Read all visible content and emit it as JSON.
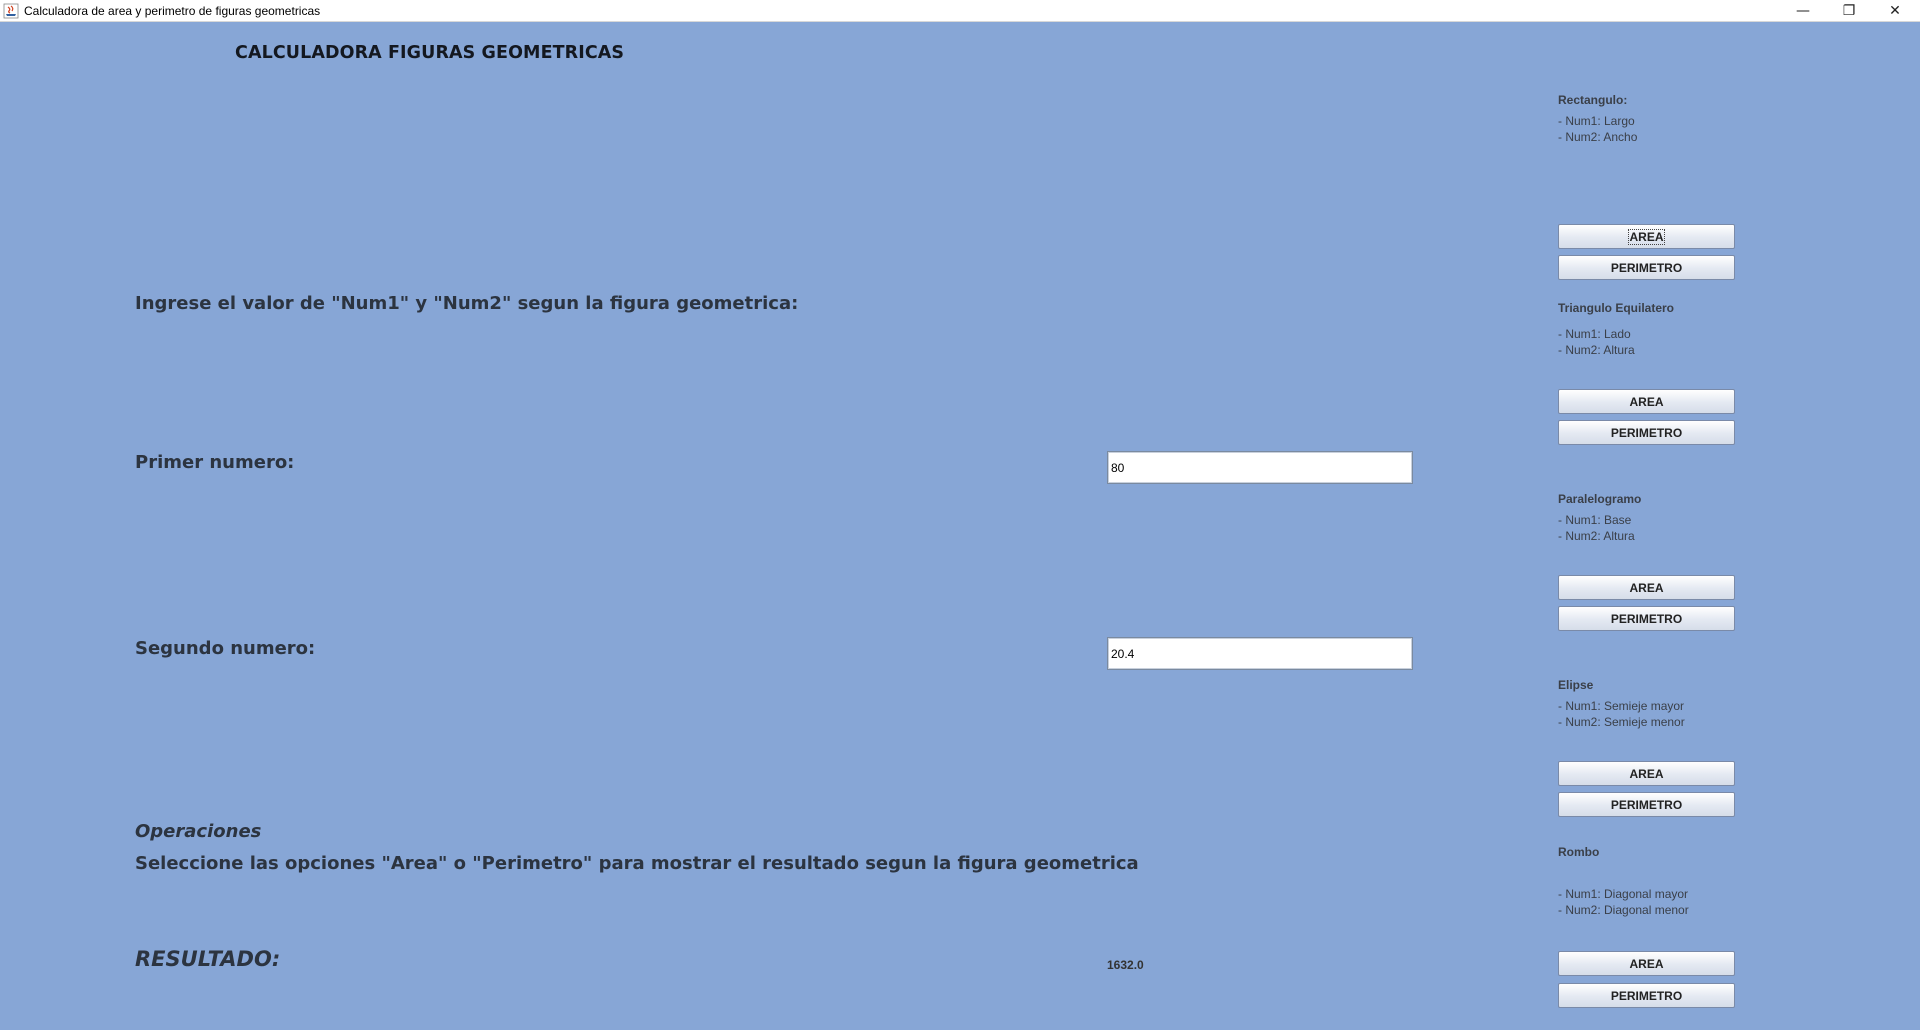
{
  "window": {
    "title": "Calculadora de area y perimetro de figuras geometricas",
    "minimize_glyph": "—",
    "maximize_glyph": "❐",
    "close_glyph": "✕"
  },
  "main": {
    "title": "CALCULADORA FIGURAS GEOMETRICAS",
    "instruction": "Ingrese el valor de \"Num1\" y \"Num2\" segun la figura geometrica:",
    "first_label": "Primer numero:",
    "first_value": "80",
    "second_label": "Segundo numero:",
    "second_value": "20.4",
    "operations_heading": "Operaciones",
    "operations_text": "Seleccione las opciones \"Area\" o \"Perimetro\" para mostrar el resultado segun la figura geometrica",
    "result_label": "RESULTADO:",
    "result_value": "1632.0"
  },
  "figures": [
    {
      "name": "Rectangulo:",
      "num1": "- Num1: Largo",
      "num2": "- Num2: Ancho",
      "area_label": "AREA",
      "perimeter_label": "PERIMETRO"
    },
    {
      "name": "Triangulo Equilatero",
      "num1": "- Num1: Lado",
      "num2": "- Num2: Altura",
      "area_label": "AREA",
      "perimeter_label": "PERIMETRO"
    },
    {
      "name": "Paralelogramo",
      "num1": "- Num1: Base",
      "num2": "- Num2: Altura",
      "area_label": "AREA",
      "perimeter_label": "PERIMETRO"
    },
    {
      "name": "Elipse",
      "num1": "- Num1: Semieje mayor",
      "num2": "- Num2: Semieje menor",
      "area_label": "AREA",
      "perimeter_label": "PERIMETRO"
    },
    {
      "name": "Rombo",
      "num1": "- Num1: Diagonal mayor",
      "num2": "- Num2: Diagonal menor",
      "area_label": "AREA",
      "perimeter_label": "PERIMETRO"
    }
  ],
  "colors": {
    "background": "#87a6d6",
    "titlebar": "#ffffff"
  }
}
